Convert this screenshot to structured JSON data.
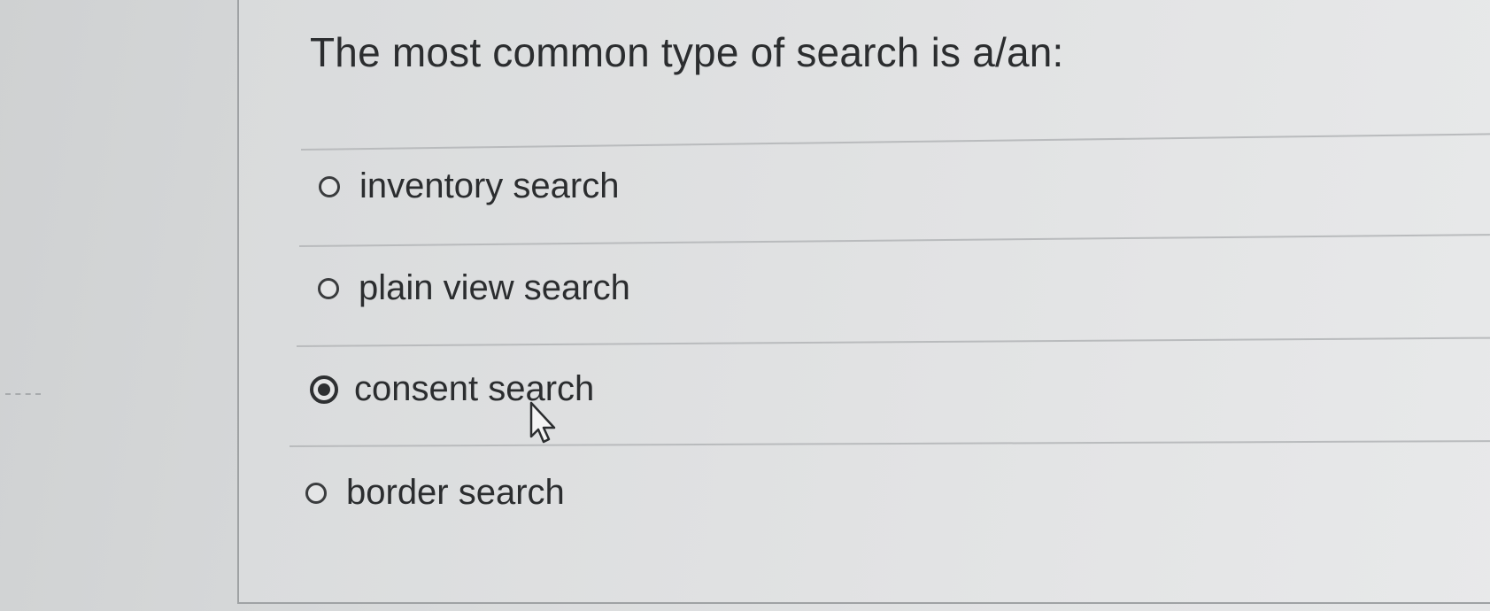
{
  "question": {
    "text": "The most common type of search is a/an:"
  },
  "options": [
    {
      "label": "inventory search",
      "selected": false
    },
    {
      "label": "plain view search",
      "selected": false
    },
    {
      "label": "consent search",
      "selected": true
    },
    {
      "label": "border search",
      "selected": false
    }
  ],
  "colors": {
    "text": "#2b2d2f",
    "divider": "#b9bbbd",
    "panel_border": "#9fa2a4"
  },
  "icons": {
    "cursor": "mouse-pointer-icon",
    "radio_unselected": "radio-empty-icon",
    "radio_selected": "radio-filled-icon"
  }
}
